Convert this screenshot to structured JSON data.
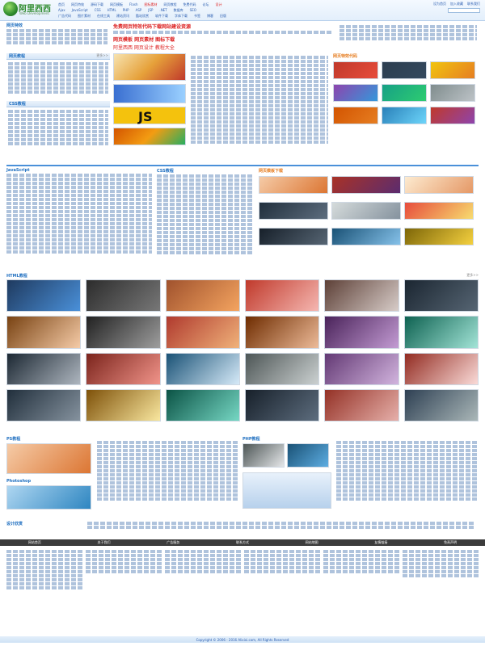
{
  "site": {
    "logo_text": "阿里西西",
    "logo_sub": "Web Development",
    "colors": {
      "accent": "#1f6fc0",
      "red": "#dd2222",
      "footer_bar": "#3b3b3b"
    }
  },
  "header": {
    "nav_rows": [
      [
        "首页",
        "网页特效",
        "源码下载",
        "网页模板",
        "Flash",
        "图标素材",
        "网页教程",
        "免费代码",
        "论坛",
        "设计"
      ],
      [
        "Ajax",
        "JavaScript",
        "CSS",
        "HTML",
        "PHP",
        "ASP",
        "JSP",
        ".NET",
        "数据库",
        "SEO"
      ],
      [
        "广告代码",
        "图片素材",
        "在线工具",
        "建站资讯",
        "酷站欣赏",
        "软件下载",
        "字体下载",
        "书签",
        "博客",
        "旧版"
      ]
    ],
    "top_links": [
      "设为首页",
      "加入收藏",
      "联系我们"
    ]
  },
  "sections": {
    "top_left_title": "网页特效",
    "news_title": "网页教程",
    "downloads_title": "网页特效代码",
    "js_title": "JavaScript",
    "css_title": "CSS教程",
    "templates_title": "网页模板下载",
    "html_title": "HTML教程",
    "php_title": "PHP教程",
    "photo_title": "PS教程",
    "icons_title": "Photoshop",
    "design_title": "设计欣赏",
    "more": "更多>>"
  },
  "headline": {
    "line1": "免费网页特效代码下载网站建设资源",
    "line2": "网页模板 网页素材 图标下载",
    "line3": "阿里西西 网页设计 教程大全"
  },
  "banner_text": "JS",
  "footer": {
    "bar_items": [
      "网站首页",
      "关于我们",
      "广告服务",
      "联系方式",
      "网站地图",
      "友情链接",
      "免责声明"
    ],
    "copyright": "Copyright © 2006 - 2016 Alixixi.com, All Rights Reserved"
  }
}
